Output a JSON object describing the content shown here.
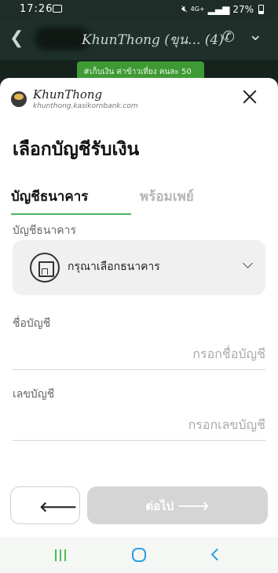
{
  "status_bar": {
    "time": "17:26",
    "network": "4G+",
    "battery": "27%"
  },
  "chat_header": {
    "contact_name": "KhunThong (ขุน... (4)"
  },
  "chat_preview": {
    "text": "#เก็บเงิน ค่าข้าวเที่ยง คนละ 50"
  },
  "brand": {
    "name": "KhunThong",
    "url": "khunthong.kasikornbank.com"
  },
  "page": {
    "title": "เลือกบัญชีรับเงิน"
  },
  "tabs": [
    {
      "label": "บัญชีธนาคาร",
      "active": true
    },
    {
      "label": "พร้อมเพย์",
      "active": false
    }
  ],
  "form": {
    "bank_label": "บัญชีธนาคาร",
    "bank_placeholder": "กรุณาเลือกธนาคาร",
    "account_name_label": "ชื่อบัญชี",
    "account_name_placeholder": "กรอกชื่อบัญชี",
    "account_name_value": "",
    "account_number_label": "เลขบัญชี",
    "account_number_placeholder": "กรอกเลขบัญชี",
    "account_number_value": ""
  },
  "buttons": {
    "back_symbol": "🡐",
    "next_label": "ต่อไป 🡒"
  },
  "colors": {
    "accent_green": "#4fb866",
    "disabled_button": "#d5d5d5",
    "nav_green": "#4cbf5a",
    "nav_blue": "#2b9fe0"
  }
}
